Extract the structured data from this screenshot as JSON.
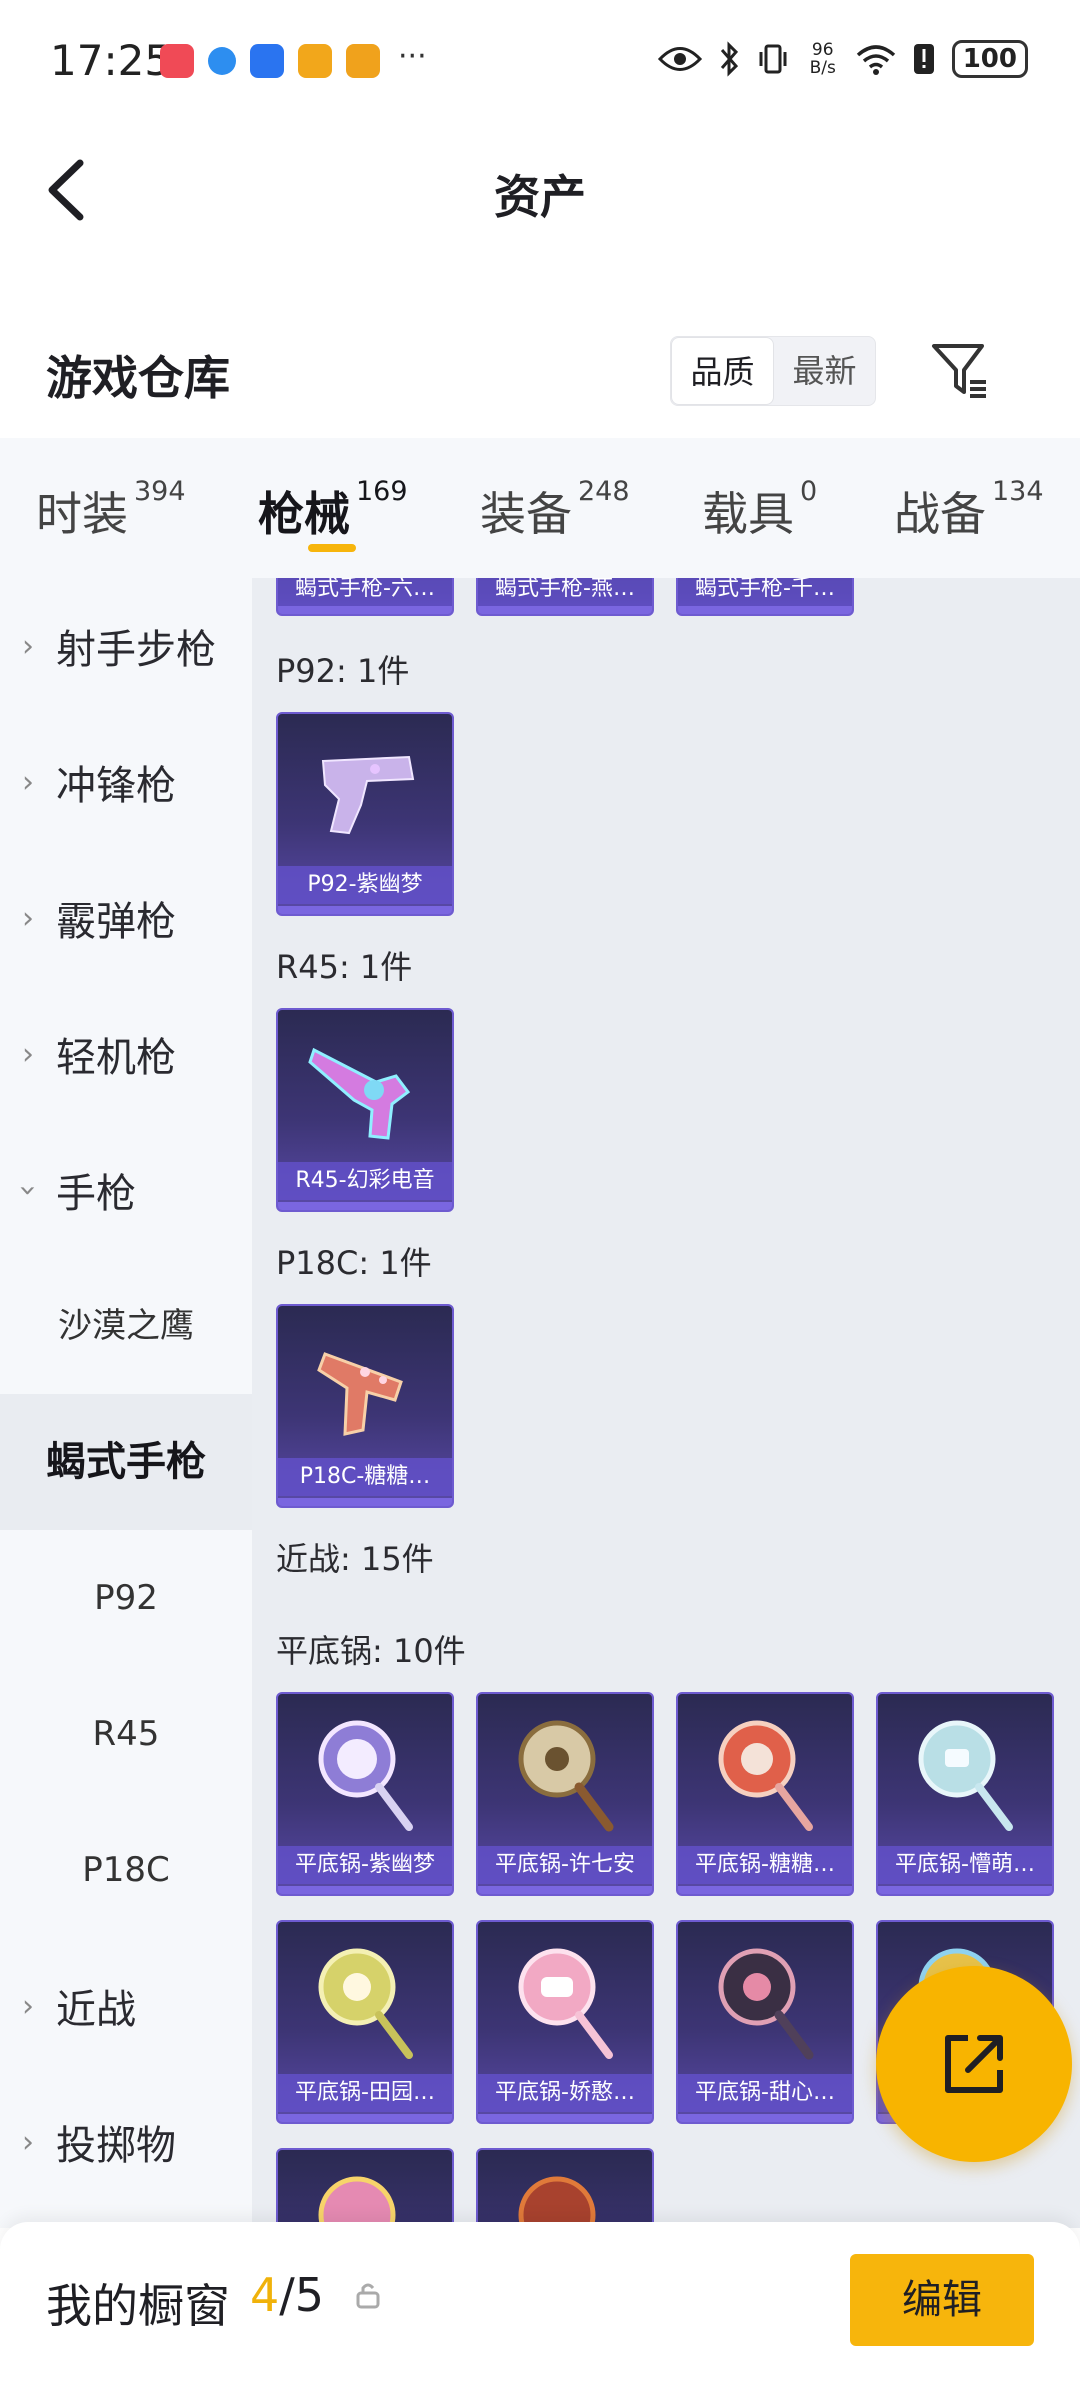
{
  "status": {
    "time": "17:25",
    "speed_top": "96",
    "speed_bottom": "B/s",
    "battery": "100"
  },
  "header": {
    "title": "资产"
  },
  "section": {
    "title": "游戏仓库",
    "sort_quality": "品质",
    "sort_latest": "最新"
  },
  "tabs": [
    {
      "label": "时装",
      "count": "394"
    },
    {
      "label": "枪械",
      "count": "169"
    },
    {
      "label": "装备",
      "count": "248"
    },
    {
      "label": "载具",
      "count": "0"
    },
    {
      "label": "战备",
      "count": "134"
    }
  ],
  "sidebar": {
    "items": [
      {
        "label": "射手步枪"
      },
      {
        "label": "冲锋枪"
      },
      {
        "label": "霰弹枪"
      },
      {
        "label": "轻机枪"
      },
      {
        "label": "手枪"
      },
      {
        "label": "沙漠之鹰"
      },
      {
        "label": "蝎式手枪"
      },
      {
        "label": "P92"
      },
      {
        "label": "R45"
      },
      {
        "label": "P18C"
      },
      {
        "label": "近战"
      },
      {
        "label": "投掷物"
      }
    ]
  },
  "content": {
    "top_partial": [
      "蝎式手枪-六…",
      "蝎式手枪-燕…",
      "蝎式手枪-千…"
    ],
    "p92_label": "P92: 1件",
    "p92_items": [
      "P92-紫幽梦"
    ],
    "r45_label": "R45: 1件",
    "r45_items": [
      "R45-幻彩电音"
    ],
    "p18c_label": "P18C: 1件",
    "p18c_items": [
      "P18C-糖糖…"
    ],
    "melee_label": "近战: 15件",
    "pan_label": "平底锅: 10件",
    "pan_items": [
      "平底锅-紫幽梦",
      "平底锅-许七安",
      "平底锅-糖糖…",
      "平底锅-懵萌…",
      "平底锅-田园…",
      "平底锅-娇憨…",
      "平底锅-甜心…",
      ""
    ]
  },
  "bottom": {
    "title": "我的橱窗",
    "current": "4",
    "total": "/5",
    "edit": "编辑"
  },
  "colors": {
    "accent": "#f7b50c",
    "card_purple": "#3d3575",
    "card_border": "#6e5bd0"
  }
}
